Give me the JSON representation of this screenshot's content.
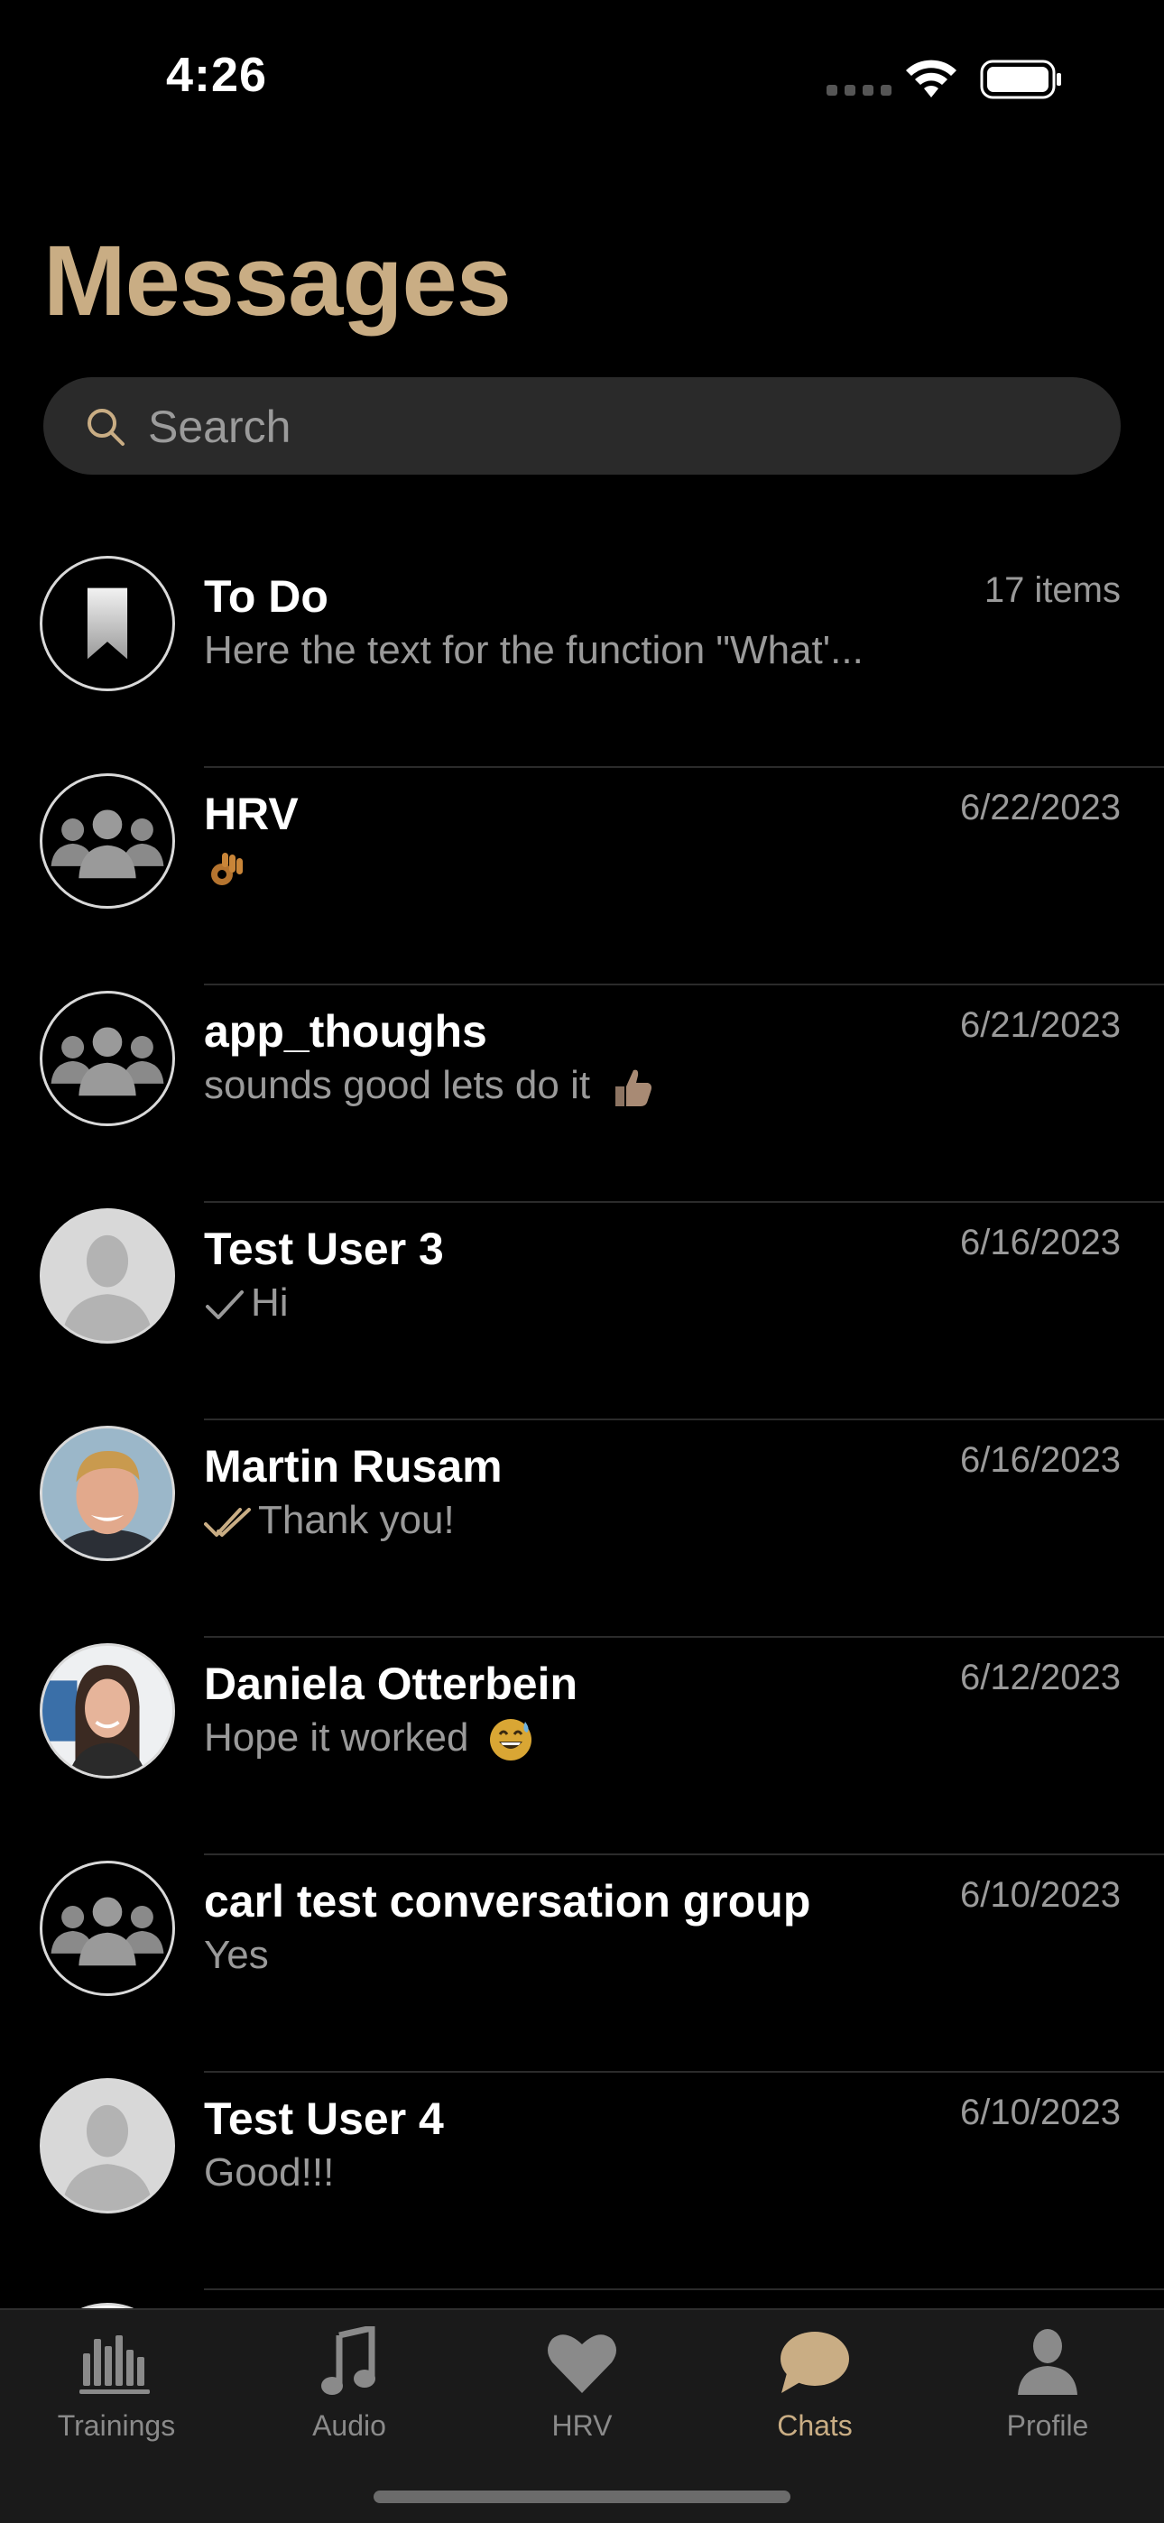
{
  "status_bar": {
    "time": "4:26"
  },
  "header": {
    "title": "Messages"
  },
  "search": {
    "placeholder": "Search"
  },
  "chats": [
    {
      "name": "To Do",
      "preview": "Here the text for the function \"What'...",
      "date": "17 items",
      "avatar": "bookmark-icon"
    },
    {
      "name": "HRV",
      "preview": "",
      "preview_emoji": "ok-hand-emoji",
      "date": "6/22/2023",
      "avatar": "group-icon"
    },
    {
      "name": "app_thoughs",
      "preview": "sounds good lets do it",
      "preview_emoji": "thumbs-up-emoji",
      "date": "6/21/2023",
      "avatar": "group-icon"
    },
    {
      "name": "Test User 3",
      "preview": "Hi",
      "status": "sent-check-icon",
      "date": "6/16/2023",
      "avatar": "person-placeholder-icon"
    },
    {
      "name": "Martin Rusam",
      "preview": "Thank you!",
      "status": "read-double-check-icon",
      "date": "6/16/2023",
      "avatar": "photo"
    },
    {
      "name": "Daniela Otterbein",
      "preview": "Hope it worked",
      "preview_emoji": "sweat-smile-emoji",
      "date": "6/12/2023",
      "avatar": "photo"
    },
    {
      "name": "carl test conversation group",
      "preview": "Yes",
      "date": "6/10/2023",
      "avatar": "group-icon"
    },
    {
      "name": "Test User 4",
      "preview": "Good!!!",
      "date": "6/10/2023",
      "avatar": "person-placeholder-icon"
    }
  ],
  "tabs": [
    {
      "label": "Trainings",
      "icon": "bars-icon",
      "active": false
    },
    {
      "label": "Audio",
      "icon": "music-note-icon",
      "active": false
    },
    {
      "label": "HRV",
      "icon": "heart-icon",
      "active": false
    },
    {
      "label": "Chats",
      "icon": "chat-bubble-icon",
      "active": true
    },
    {
      "label": "Profile",
      "icon": "person-icon",
      "active": false
    }
  ],
  "colors": {
    "accent": "#c9ad84",
    "background": "#000000",
    "search_bg": "#2a2a2a",
    "tab_bar_bg": "#1a1a1a"
  }
}
